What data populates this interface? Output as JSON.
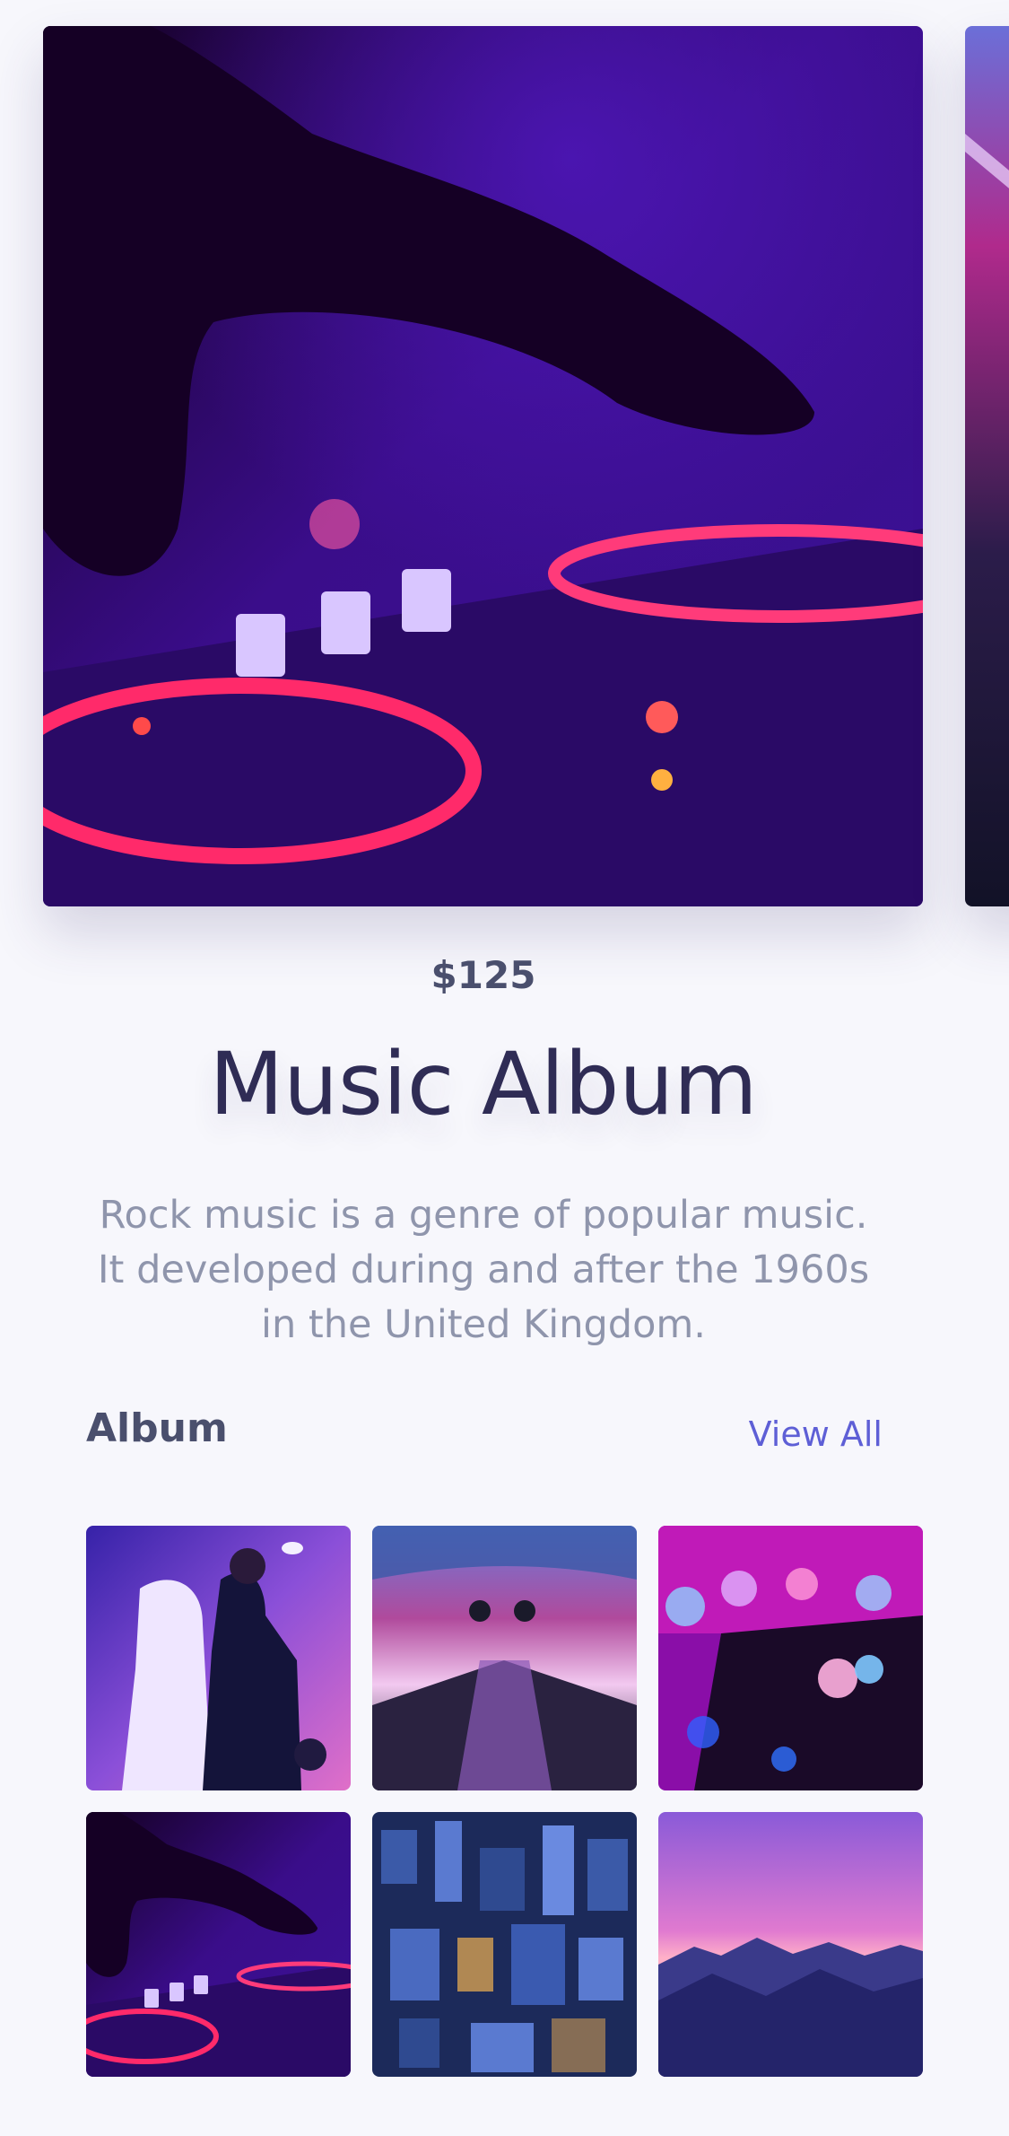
{
  "product": {
    "price": "$125",
    "title": "Music Album",
    "description": "Rock music is a genre of popular music. It developed during and after the 1960s in the United Kingdom."
  },
  "album": {
    "heading": "Album",
    "view_all_label": "View All"
  },
  "images": {
    "hero": "dj-turntable-image",
    "next": "neon-corridor-image",
    "thumbs": [
      "couple-dancing-image",
      "neon-corridor-image",
      "purple-crystals-image",
      "dj-turntable-image",
      "city-night-image",
      "mountain-sunset-image"
    ]
  },
  "colors": {
    "background": "#f7f7fc",
    "title": "#2f2c55",
    "price": "#4a4f6d",
    "description": "#8f95ac",
    "link": "#5e5fd6"
  }
}
